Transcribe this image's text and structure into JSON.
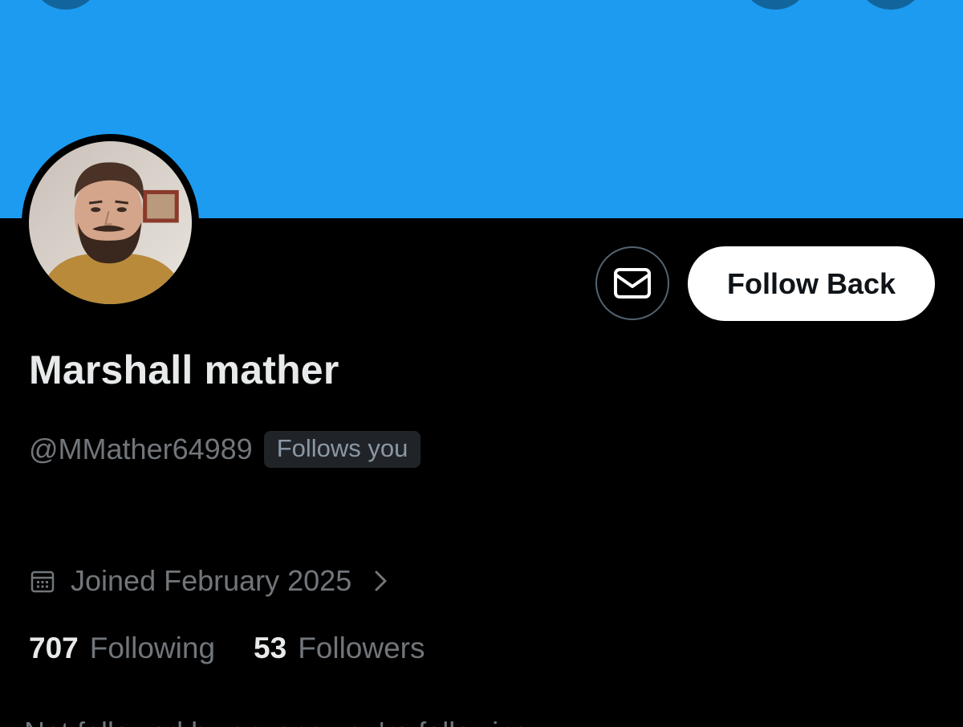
{
  "profile": {
    "display_name": "Marshall mather",
    "handle": "@MMather64989",
    "follows_you_badge": "Follows you",
    "joined": "Joined February 2025",
    "stats": {
      "following_count": "707",
      "following_label": "Following",
      "followers_count": "53",
      "followers_label": "Followers"
    },
    "bottom_line": "Not followed by anyone you're following"
  },
  "actions": {
    "follow_back_label": "Follow Back"
  },
  "icons": {
    "message": "envelope-icon",
    "calendar": "calendar-icon",
    "chevron": "chevron-right-icon"
  },
  "colors": {
    "banner": "#1d9bf0",
    "background": "#000000",
    "primary_text": "#e7e9ea",
    "secondary_text": "#71767b",
    "badge_bg": "#202327",
    "button_bg": "#ffffff"
  }
}
